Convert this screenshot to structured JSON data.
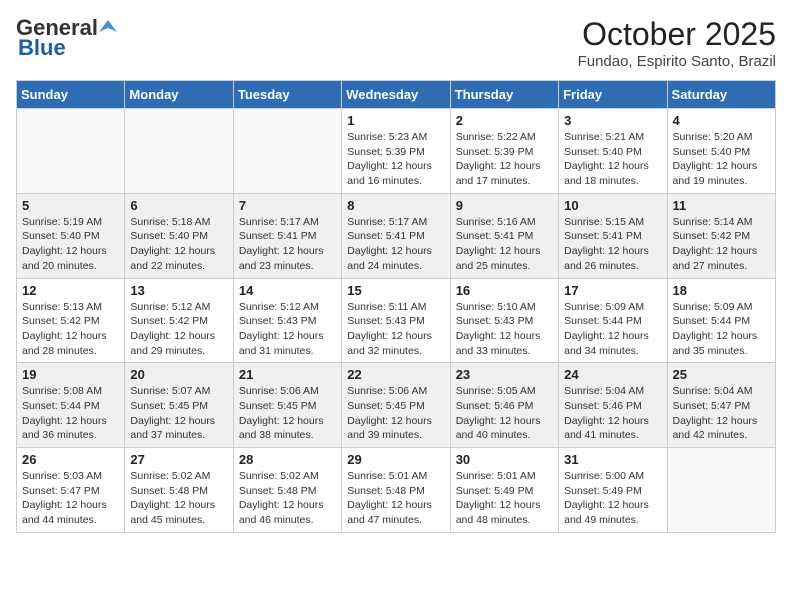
{
  "logo": {
    "general": "General",
    "blue": "Blue"
  },
  "title": "October 2025",
  "subtitle": "Fundao, Espirito Santo, Brazil",
  "days_of_week": [
    "Sunday",
    "Monday",
    "Tuesday",
    "Wednesday",
    "Thursday",
    "Friday",
    "Saturday"
  ],
  "weeks": [
    {
      "shaded": false,
      "days": [
        {
          "num": "",
          "info": ""
        },
        {
          "num": "",
          "info": ""
        },
        {
          "num": "",
          "info": ""
        },
        {
          "num": "1",
          "info": "Sunrise: 5:23 AM\nSunset: 5:39 PM\nDaylight: 12 hours and 16 minutes."
        },
        {
          "num": "2",
          "info": "Sunrise: 5:22 AM\nSunset: 5:39 PM\nDaylight: 12 hours and 17 minutes."
        },
        {
          "num": "3",
          "info": "Sunrise: 5:21 AM\nSunset: 5:40 PM\nDaylight: 12 hours and 18 minutes."
        },
        {
          "num": "4",
          "info": "Sunrise: 5:20 AM\nSunset: 5:40 PM\nDaylight: 12 hours and 19 minutes."
        }
      ]
    },
    {
      "shaded": true,
      "days": [
        {
          "num": "5",
          "info": "Sunrise: 5:19 AM\nSunset: 5:40 PM\nDaylight: 12 hours and 20 minutes."
        },
        {
          "num": "6",
          "info": "Sunrise: 5:18 AM\nSunset: 5:40 PM\nDaylight: 12 hours and 22 minutes."
        },
        {
          "num": "7",
          "info": "Sunrise: 5:17 AM\nSunset: 5:41 PM\nDaylight: 12 hours and 23 minutes."
        },
        {
          "num": "8",
          "info": "Sunrise: 5:17 AM\nSunset: 5:41 PM\nDaylight: 12 hours and 24 minutes."
        },
        {
          "num": "9",
          "info": "Sunrise: 5:16 AM\nSunset: 5:41 PM\nDaylight: 12 hours and 25 minutes."
        },
        {
          "num": "10",
          "info": "Sunrise: 5:15 AM\nSunset: 5:41 PM\nDaylight: 12 hours and 26 minutes."
        },
        {
          "num": "11",
          "info": "Sunrise: 5:14 AM\nSunset: 5:42 PM\nDaylight: 12 hours and 27 minutes."
        }
      ]
    },
    {
      "shaded": false,
      "days": [
        {
          "num": "12",
          "info": "Sunrise: 5:13 AM\nSunset: 5:42 PM\nDaylight: 12 hours and 28 minutes."
        },
        {
          "num": "13",
          "info": "Sunrise: 5:12 AM\nSunset: 5:42 PM\nDaylight: 12 hours and 29 minutes."
        },
        {
          "num": "14",
          "info": "Sunrise: 5:12 AM\nSunset: 5:43 PM\nDaylight: 12 hours and 31 minutes."
        },
        {
          "num": "15",
          "info": "Sunrise: 5:11 AM\nSunset: 5:43 PM\nDaylight: 12 hours and 32 minutes."
        },
        {
          "num": "16",
          "info": "Sunrise: 5:10 AM\nSunset: 5:43 PM\nDaylight: 12 hours and 33 minutes."
        },
        {
          "num": "17",
          "info": "Sunrise: 5:09 AM\nSunset: 5:44 PM\nDaylight: 12 hours and 34 minutes."
        },
        {
          "num": "18",
          "info": "Sunrise: 5:09 AM\nSunset: 5:44 PM\nDaylight: 12 hours and 35 minutes."
        }
      ]
    },
    {
      "shaded": true,
      "days": [
        {
          "num": "19",
          "info": "Sunrise: 5:08 AM\nSunset: 5:44 PM\nDaylight: 12 hours and 36 minutes."
        },
        {
          "num": "20",
          "info": "Sunrise: 5:07 AM\nSunset: 5:45 PM\nDaylight: 12 hours and 37 minutes."
        },
        {
          "num": "21",
          "info": "Sunrise: 5:06 AM\nSunset: 5:45 PM\nDaylight: 12 hours and 38 minutes."
        },
        {
          "num": "22",
          "info": "Sunrise: 5:06 AM\nSunset: 5:45 PM\nDaylight: 12 hours and 39 minutes."
        },
        {
          "num": "23",
          "info": "Sunrise: 5:05 AM\nSunset: 5:46 PM\nDaylight: 12 hours and 40 minutes."
        },
        {
          "num": "24",
          "info": "Sunrise: 5:04 AM\nSunset: 5:46 PM\nDaylight: 12 hours and 41 minutes."
        },
        {
          "num": "25",
          "info": "Sunrise: 5:04 AM\nSunset: 5:47 PM\nDaylight: 12 hours and 42 minutes."
        }
      ]
    },
    {
      "shaded": false,
      "days": [
        {
          "num": "26",
          "info": "Sunrise: 5:03 AM\nSunset: 5:47 PM\nDaylight: 12 hours and 44 minutes."
        },
        {
          "num": "27",
          "info": "Sunrise: 5:02 AM\nSunset: 5:48 PM\nDaylight: 12 hours and 45 minutes."
        },
        {
          "num": "28",
          "info": "Sunrise: 5:02 AM\nSunset: 5:48 PM\nDaylight: 12 hours and 46 minutes."
        },
        {
          "num": "29",
          "info": "Sunrise: 5:01 AM\nSunset: 5:48 PM\nDaylight: 12 hours and 47 minutes."
        },
        {
          "num": "30",
          "info": "Sunrise: 5:01 AM\nSunset: 5:49 PM\nDaylight: 12 hours and 48 minutes."
        },
        {
          "num": "31",
          "info": "Sunrise: 5:00 AM\nSunset: 5:49 PM\nDaylight: 12 hours and 49 minutes."
        },
        {
          "num": "",
          "info": ""
        }
      ]
    }
  ]
}
